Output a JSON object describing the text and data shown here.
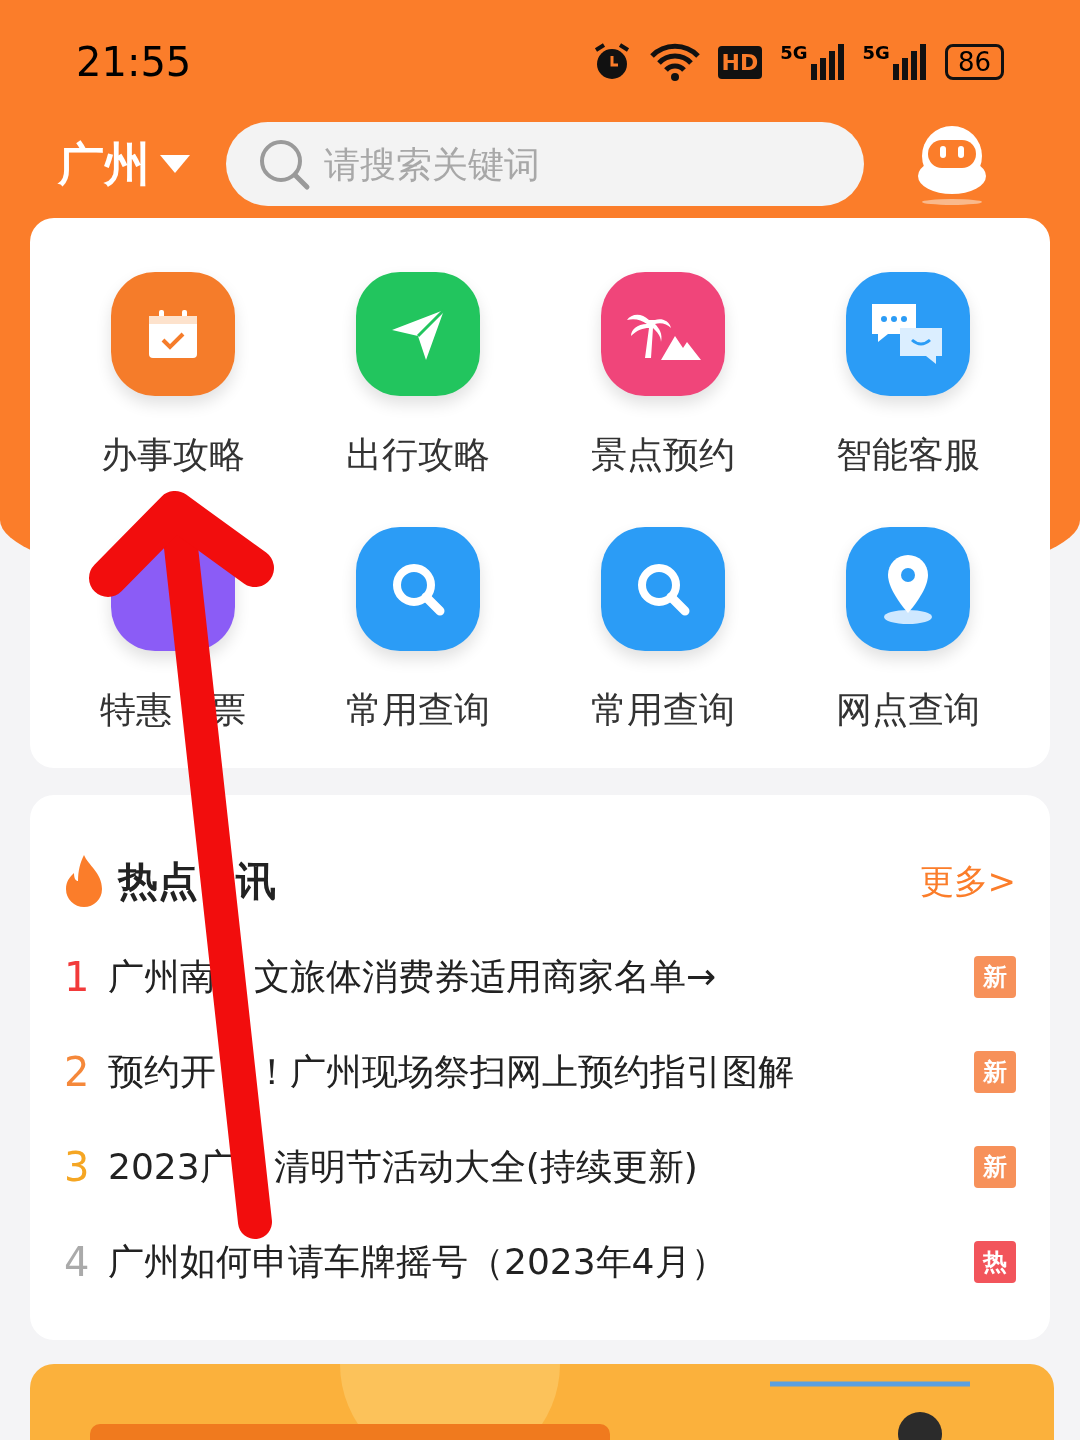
{
  "status_bar": {
    "time": "21:55",
    "hd": "HD",
    "signals": [
      "5G",
      "5G"
    ],
    "battery": "86"
  },
  "header": {
    "city": "广州",
    "search": {
      "placeholder": "请搜索关键词"
    }
  },
  "services": [
    {
      "label": "办事攻略",
      "kind": "calendar",
      "color": "#f57c2a"
    },
    {
      "label": "出行攻略",
      "kind": "send",
      "color": "#22c55e"
    },
    {
      "label": "景点预约",
      "kind": "palm",
      "color": "#f0457a"
    },
    {
      "label": "智能客服",
      "kind": "chat",
      "color": "#2b9cf6"
    },
    {
      "label_parts": [
        "特惠",
        "票"
      ],
      "kind": "covered",
      "color": "#8b5cf6"
    },
    {
      "label": "常用查询",
      "kind": "search",
      "color": "#2b9cf6"
    },
    {
      "label": "常用查询",
      "kind": "search",
      "color": "#2b9cf6"
    },
    {
      "label": "网点查询",
      "kind": "pin",
      "color": "#2b9cf6"
    }
  ],
  "news": {
    "title_parts": [
      "热点",
      "讯"
    ],
    "more": "更多>",
    "items": [
      {
        "rank": "1",
        "color": "#f23a3a",
        "text_parts": [
          "广州南",
          "文旅体消费券适用商家名单→"
        ],
        "badge": {
          "text": "新",
          "color": "#f7915a"
        }
      },
      {
        "rank": "2",
        "color": "#f5883a",
        "text_parts": [
          "预约开",
          "！广州现场祭扫网上预约指引图解"
        ],
        "badge": {
          "text": "新",
          "color": "#f7915a"
        }
      },
      {
        "rank": "3",
        "color": "#f5a623",
        "text_parts": [
          "2023广",
          "清明节活动大全(持续更新)"
        ],
        "badge": {
          "text": "新",
          "color": "#f7915a"
        }
      },
      {
        "rank": "4",
        "color": "#aaaaaa",
        "text_parts": [
          "广州如何申请车牌摇号（2023年4月）"
        ],
        "badge": {
          "text": "热",
          "color": "#f2545b"
        }
      }
    ]
  },
  "annotation": {
    "kind": "arrow"
  }
}
